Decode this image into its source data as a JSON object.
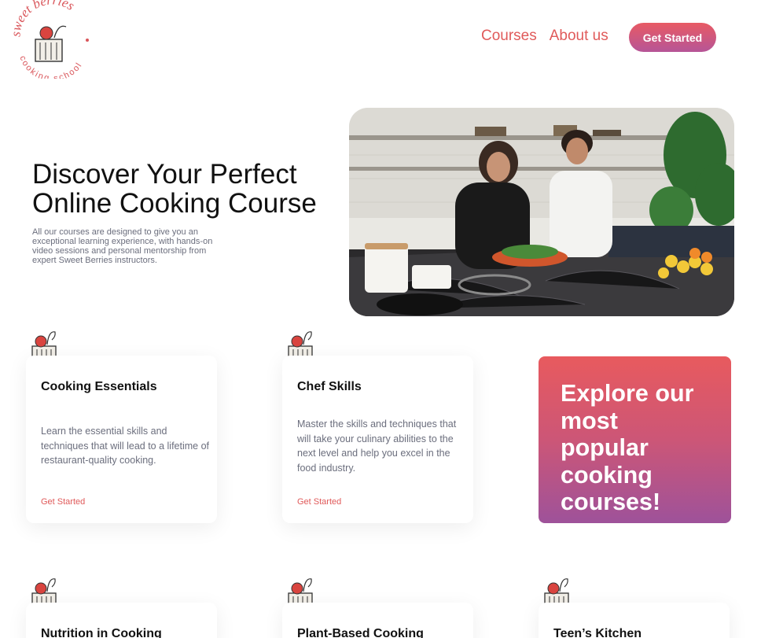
{
  "brand": {
    "logo_top": "sweet berries",
    "logo_bottom": "cooking school"
  },
  "nav": {
    "items": [
      "Courses",
      "About us"
    ],
    "cta": "Get Started"
  },
  "hero": {
    "title": "Discover Your Perfect Online Cooking Course",
    "subtitle": "All our courses are designed to give you an exceptional learning experience, with hands-on video sessions and personal mentorship from expert Sweet Berries instructors."
  },
  "cards": [
    {
      "title": "Cooking Essentials",
      "body": "Learn the essential skills and techniques that will lead to a lifetime of restaurant-quality cooking.",
      "link": "Get Started"
    },
    {
      "title": "Chef Skills",
      "body": "Master the skills and techniques that will take your culinary abilities to the next level and help you excel in the food industry.",
      "link": "Get Started"
    },
    {
      "title": "Nutrition in Cooking"
    },
    {
      "title": "Plant-Based Cooking"
    },
    {
      "title": "Teen’s Kitchen"
    }
  ],
  "promo": {
    "text": "Explore our most popular cooking courses!"
  },
  "colors": {
    "accent": "#e05a5a",
    "gradient_start": "#e85a5e",
    "gradient_end": "#9e529a"
  }
}
